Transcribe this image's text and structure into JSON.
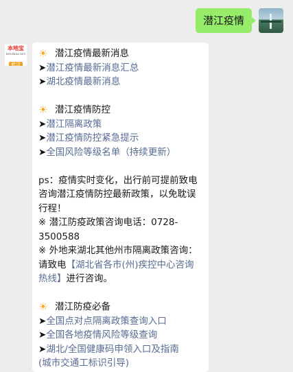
{
  "outgoing": {
    "text": "潜江疫情"
  },
  "bot": {
    "brand": "本地宝",
    "site": "bendibao.com",
    "city": "武汉"
  },
  "sections": [
    {
      "title": "潜江疫情最新消息",
      "links": [
        "潜江疫情最新消息汇总",
        "湖北疫情最新消息"
      ]
    },
    {
      "title": "潜江疫情防控",
      "links": [
        "潜江隔离政策",
        "潜江疫情防控紧急提示",
        "全国风险等级名单（持续更新）"
      ]
    }
  ],
  "notice": {
    "ps": "ps：疫情实时变化，出行前可提前致电咨询潜江疫情防控最新政策，以免耽误行程！",
    "hotline": "※ 潜江防疫政策咨询电话：0728-3500588",
    "other_prefix": "※ 外地来湖北其他州市隔离政策咨询：请致电",
    "other_link": "【湖北省各市(州)疾控中心咨询热线】",
    "other_suffix": "进行咨询。"
  },
  "section3": {
    "title": "潜江防疫必备",
    "links": [
      "全国点对点隔离政策查询入口",
      "全国各地疫情风险等级查询",
      "湖北/全国健康码申领入口及指南",
      "(城市交通工标识引导)"
    ]
  },
  "icons": {
    "sun": "sun-icon",
    "arrow": "arrow-right-icon"
  }
}
